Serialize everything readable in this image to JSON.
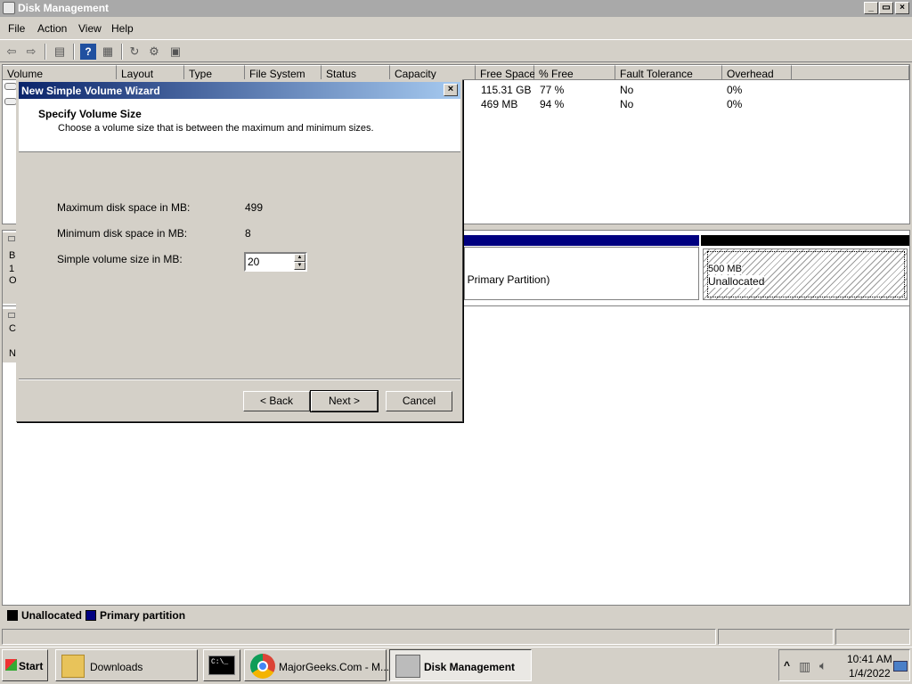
{
  "window": {
    "title": "Disk Management",
    "minimize": "_",
    "maximize": "▭",
    "close": "×"
  },
  "menu": [
    "File",
    "Action",
    "View",
    "Help"
  ],
  "columns": [
    "Volume",
    "Layout",
    "Type",
    "File System",
    "Status",
    "Capacity",
    "Free Space",
    "% Free",
    "Fault Tolerance",
    "Overhead"
  ],
  "volumes": [
    {
      "free_space": "115.31 GB",
      "percent_free": "77 %",
      "fault_tolerance": "No",
      "overhead": "0%"
    },
    {
      "free_space": "469 MB",
      "percent_free": "94 %",
      "fault_tolerance": "No",
      "overhead": "0%"
    }
  ],
  "disk_panel": {
    "disk0_left_text": [
      "B",
      "1",
      "O"
    ],
    "disk1_left_text": [
      "C",
      "N"
    ],
    "partition_primary_text": "), Primary Partition)",
    "unallocated_size": "500 MB",
    "unallocated_label": "Unallocated"
  },
  "legend": {
    "unallocated": "Unallocated",
    "primary": "Primary partition"
  },
  "colors": {
    "primary": "#000080",
    "unallocated": "#000000",
    "dialog_title_start": "#0a246a"
  },
  "dialog": {
    "title": "New Simple Volume Wizard",
    "close": "×",
    "header_title": "Specify Volume Size",
    "header_subtitle": "Choose a volume size that is between the maximum and minimum sizes.",
    "max_label": "Maximum disk space in MB:",
    "max_value": "499",
    "min_label": "Minimum disk space in MB:",
    "min_value": "8",
    "size_label": "Simple volume size in MB:",
    "size_value": "20",
    "back": "< Back",
    "next": "Next >",
    "cancel": "Cancel"
  },
  "taskbar": {
    "start": "Start",
    "items": [
      "Downloads",
      "",
      "MajorGeeks.Com - M...",
      "Disk Management"
    ],
    "tray_expand": "^",
    "time": "10:41 AM",
    "date": "1/4/2022"
  }
}
